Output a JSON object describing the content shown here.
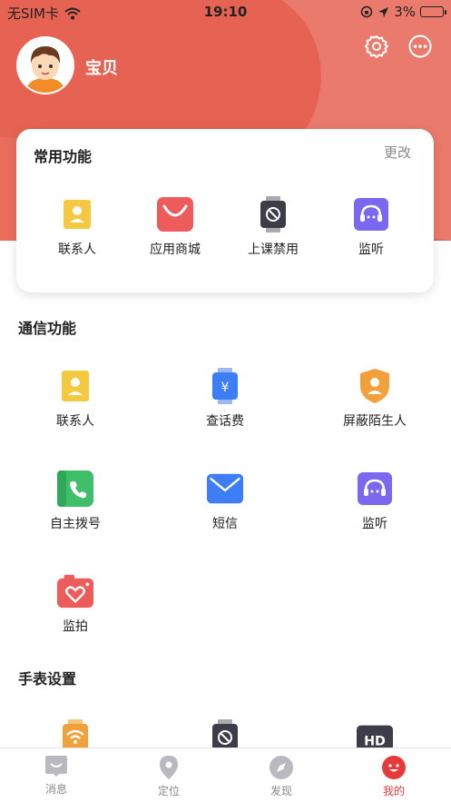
{
  "status_bar": {
    "carrier": "无SIM卡",
    "time": "19:10",
    "battery": "3%"
  },
  "profile": {
    "name": "宝贝"
  },
  "common": {
    "title": "常用功能",
    "edit": "更改",
    "items": [
      {
        "label": "联系人",
        "icon": "contacts-icon"
      },
      {
        "label": "应用商城",
        "icon": "shopping-bag-icon"
      },
      {
        "label": "上课禁用",
        "icon": "class-ban-watch-icon"
      },
      {
        "label": "监听",
        "icon": "monitor-listen-icon"
      }
    ]
  },
  "comm": {
    "title": "通信功能",
    "items": [
      {
        "label": "联系人",
        "icon": "contacts-icon"
      },
      {
        "label": "查话费",
        "icon": "phone-bill-icon"
      },
      {
        "label": "屏蔽陌生人",
        "icon": "block-stranger-icon"
      },
      {
        "label": "自主拨号",
        "icon": "dial-icon"
      },
      {
        "label": "短信",
        "icon": "sms-icon"
      },
      {
        "label": "监听",
        "icon": "monitor-listen-icon"
      },
      {
        "label": "监拍",
        "icon": "remote-photo-icon"
      }
    ]
  },
  "watch": {
    "title": "手表设置",
    "items": [
      {
        "icon": "wifi-icon"
      },
      {
        "icon": "class-ban-watch-icon"
      },
      {
        "icon": "hd-icon"
      }
    ]
  },
  "tabbar": {
    "items": [
      {
        "label": "消息"
      },
      {
        "label": "定位"
      },
      {
        "label": "发现"
      },
      {
        "label": "我的"
      }
    ],
    "active": "我的"
  },
  "colors": {
    "hero": "#e8695a",
    "accent": "#e63a3a",
    "yellow": "#f2c94c",
    "blue": "#3d7df5",
    "green": "#3fbf6a",
    "purple": "#7a68f0",
    "orange": "#f2a03a"
  }
}
